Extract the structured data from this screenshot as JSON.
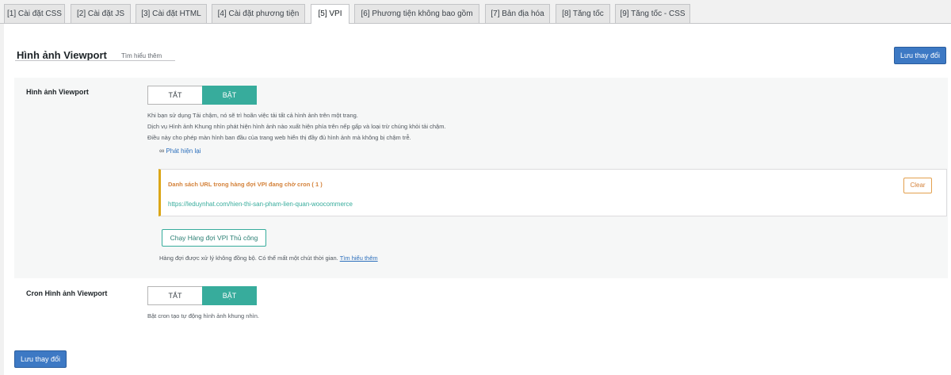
{
  "tabs": [
    {
      "label": "[1] Cài đặt CSS"
    },
    {
      "label": "[2] Cài đặt JS"
    },
    {
      "label": "[3] Cài đặt HTML"
    },
    {
      "label": "[4] Cài đặt phương tiện"
    },
    {
      "label": "[5] VPI"
    },
    {
      "label": "[6] Phương tiện không bao gồm"
    },
    {
      "label": "[7] Bản địa hóa"
    },
    {
      "label": "[8] Tăng tốc"
    },
    {
      "label": "[9] Tăng tốc - CSS"
    }
  ],
  "active_tab": "[5] VPI",
  "header": {
    "title": "Hình ảnh Viewport",
    "learn_more": "Tìm hiểu thêm",
    "save_label": "Lưu thay đổi"
  },
  "vpi": {
    "label": "Hình ảnh Viewport",
    "toggle_off": "TẮT",
    "toggle_on": "BẬT",
    "state": "on",
    "desc_lines": [
      "Khi bạn sử dụng Tải chậm, nó sẽ trì hoãn việc tải tất cả hình ảnh trên một trang.",
      "Dịch vụ Hình ảnh Khung nhìn phát hiện hình ảnh nào xuất hiện phía trên nếp gấp và loại trừ chúng khỏi tải chậm.",
      "Điều này cho phép màn hình ban đầu của trang web hiển thị đầy đủ hình ảnh mà không bị chậm trễ."
    ],
    "detect_link": "Phát hiện lại",
    "detect_icon": "infinity-icon",
    "queue": {
      "title": "Danh sách URL trong hàng đợi VPI đang chờ cron ( 1 )",
      "urls": [
        "https://leduynhat.com/hien-thi-san-pham-lien-quan-woocommerce"
      ],
      "clear_label": "Clear"
    },
    "run_button": "Chạy Hàng đợi VPI Thủ công",
    "async_note": "Hàng đợi được xử lý không đồng bộ. Có thể mất một chút thời gian.",
    "async_link": "Tìm hiểu thêm"
  },
  "cron": {
    "label": "Cron Hình ảnh Viewport",
    "toggle_off": "TẮT",
    "toggle_on": "BẬT",
    "state": "on",
    "desc": "Bật cron tạo tự động hình ảnh khung nhìn."
  },
  "footer": {
    "save_label": "Lưu thay đổi"
  },
  "colors": {
    "toggle_on": "#37ac9c",
    "save_button": "#3d79c4",
    "queue_accent": "#dba617",
    "link": "#2c6fbc"
  }
}
